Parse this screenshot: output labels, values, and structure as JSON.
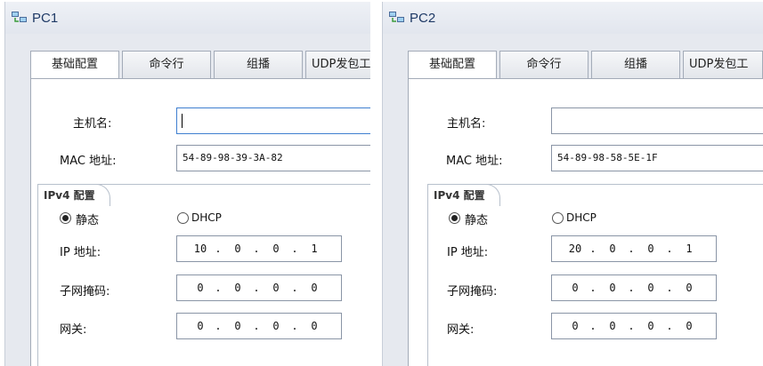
{
  "tabs": [
    "基础配置",
    "命令行",
    "组播",
    "UDP发包工"
  ],
  "labels": {
    "hostname": "主机名:",
    "mac": "MAC 地址:",
    "ipv4_config": "IPv4 配置",
    "static": "静态",
    "dhcp": "DHCP",
    "ip": "IP 地址:",
    "mask": "子网掩码:",
    "gateway": "网关:"
  },
  "pc1": {
    "title": "PC1",
    "hostname": "",
    "mac": "54-89-98-39-3A-82",
    "ip": [
      "10",
      "0",
      "0",
      "1"
    ],
    "mask": [
      "0",
      "0",
      "0",
      "0"
    ],
    "gateway": [
      "0",
      "0",
      "0",
      "0"
    ],
    "mode": "static"
  },
  "pc2": {
    "title": "PC2",
    "hostname": "",
    "mac": "54-89-98-58-5E-1F",
    "ip": [
      "20",
      "0",
      "0",
      "1"
    ],
    "mask": [
      "0",
      "0",
      "0",
      "0"
    ],
    "gateway": [
      "0",
      "0",
      "0",
      "0"
    ],
    "mode": "static"
  },
  "ip_separator": "."
}
